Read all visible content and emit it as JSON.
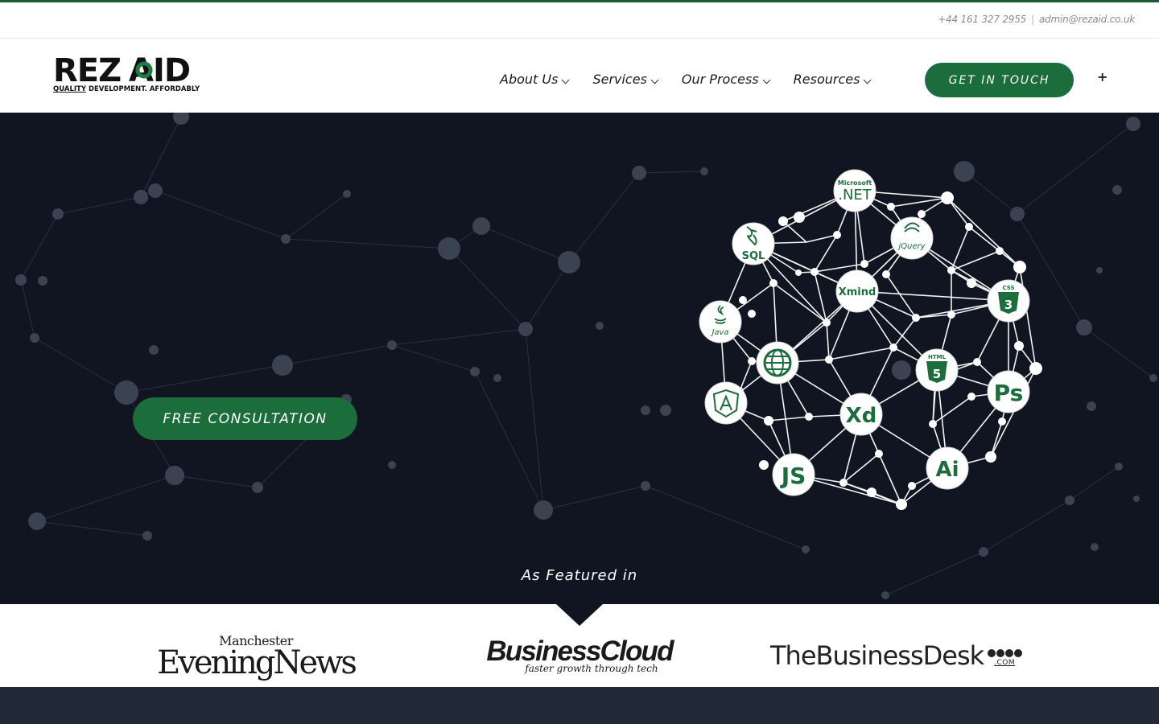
{
  "topbar": {
    "phone": "+44 161 327 2955",
    "separator": "|",
    "email": "admin@rezaid.co.uk"
  },
  "logo": {
    "word_prefix": "REZ",
    "word_accent": "AID",
    "tagline_underlined": "QUALITY",
    "tagline_rest": " DEVELOPMENT. AFFORDABLY"
  },
  "nav": {
    "items": [
      {
        "label": "About Us",
        "icon": "chevron-down-icon"
      },
      {
        "label": "Services",
        "icon": "chevron-down-icon"
      },
      {
        "label": "Our Process",
        "icon": "chevron-down-icon"
      },
      {
        "label": "Resources",
        "icon": "chevron-down-icon"
      }
    ],
    "cta_label": "GET IN TOUCH",
    "plus_icon": "+"
  },
  "hero": {
    "consult_label": "FREE CONSULTATION",
    "featured_label": "As Featured in",
    "tech_badges": [
      ".NET",
      "jQuery",
      "SQL",
      "Xmind",
      "CSS3",
      "Java",
      "Web",
      "HTML5",
      "Ps",
      "Angular",
      "Xd",
      "JS",
      "Ai"
    ],
    "tech_small": {
      "net_top": "Microsoft",
      "css_top": "CSS",
      "html_top": "HTML"
    }
  },
  "press": {
    "men_top": "Manchester",
    "men_bottom": "EveningNews",
    "bc_top": "BusinessCloud",
    "bc_tagline": "faster growth through tech",
    "tbd_name": "TheBusinessDesk",
    "tbd_com": ".COM"
  },
  "colors": {
    "brand_green": "#1b6e3b",
    "hero_bg": "#111522",
    "footer_bg": "#222a38"
  }
}
